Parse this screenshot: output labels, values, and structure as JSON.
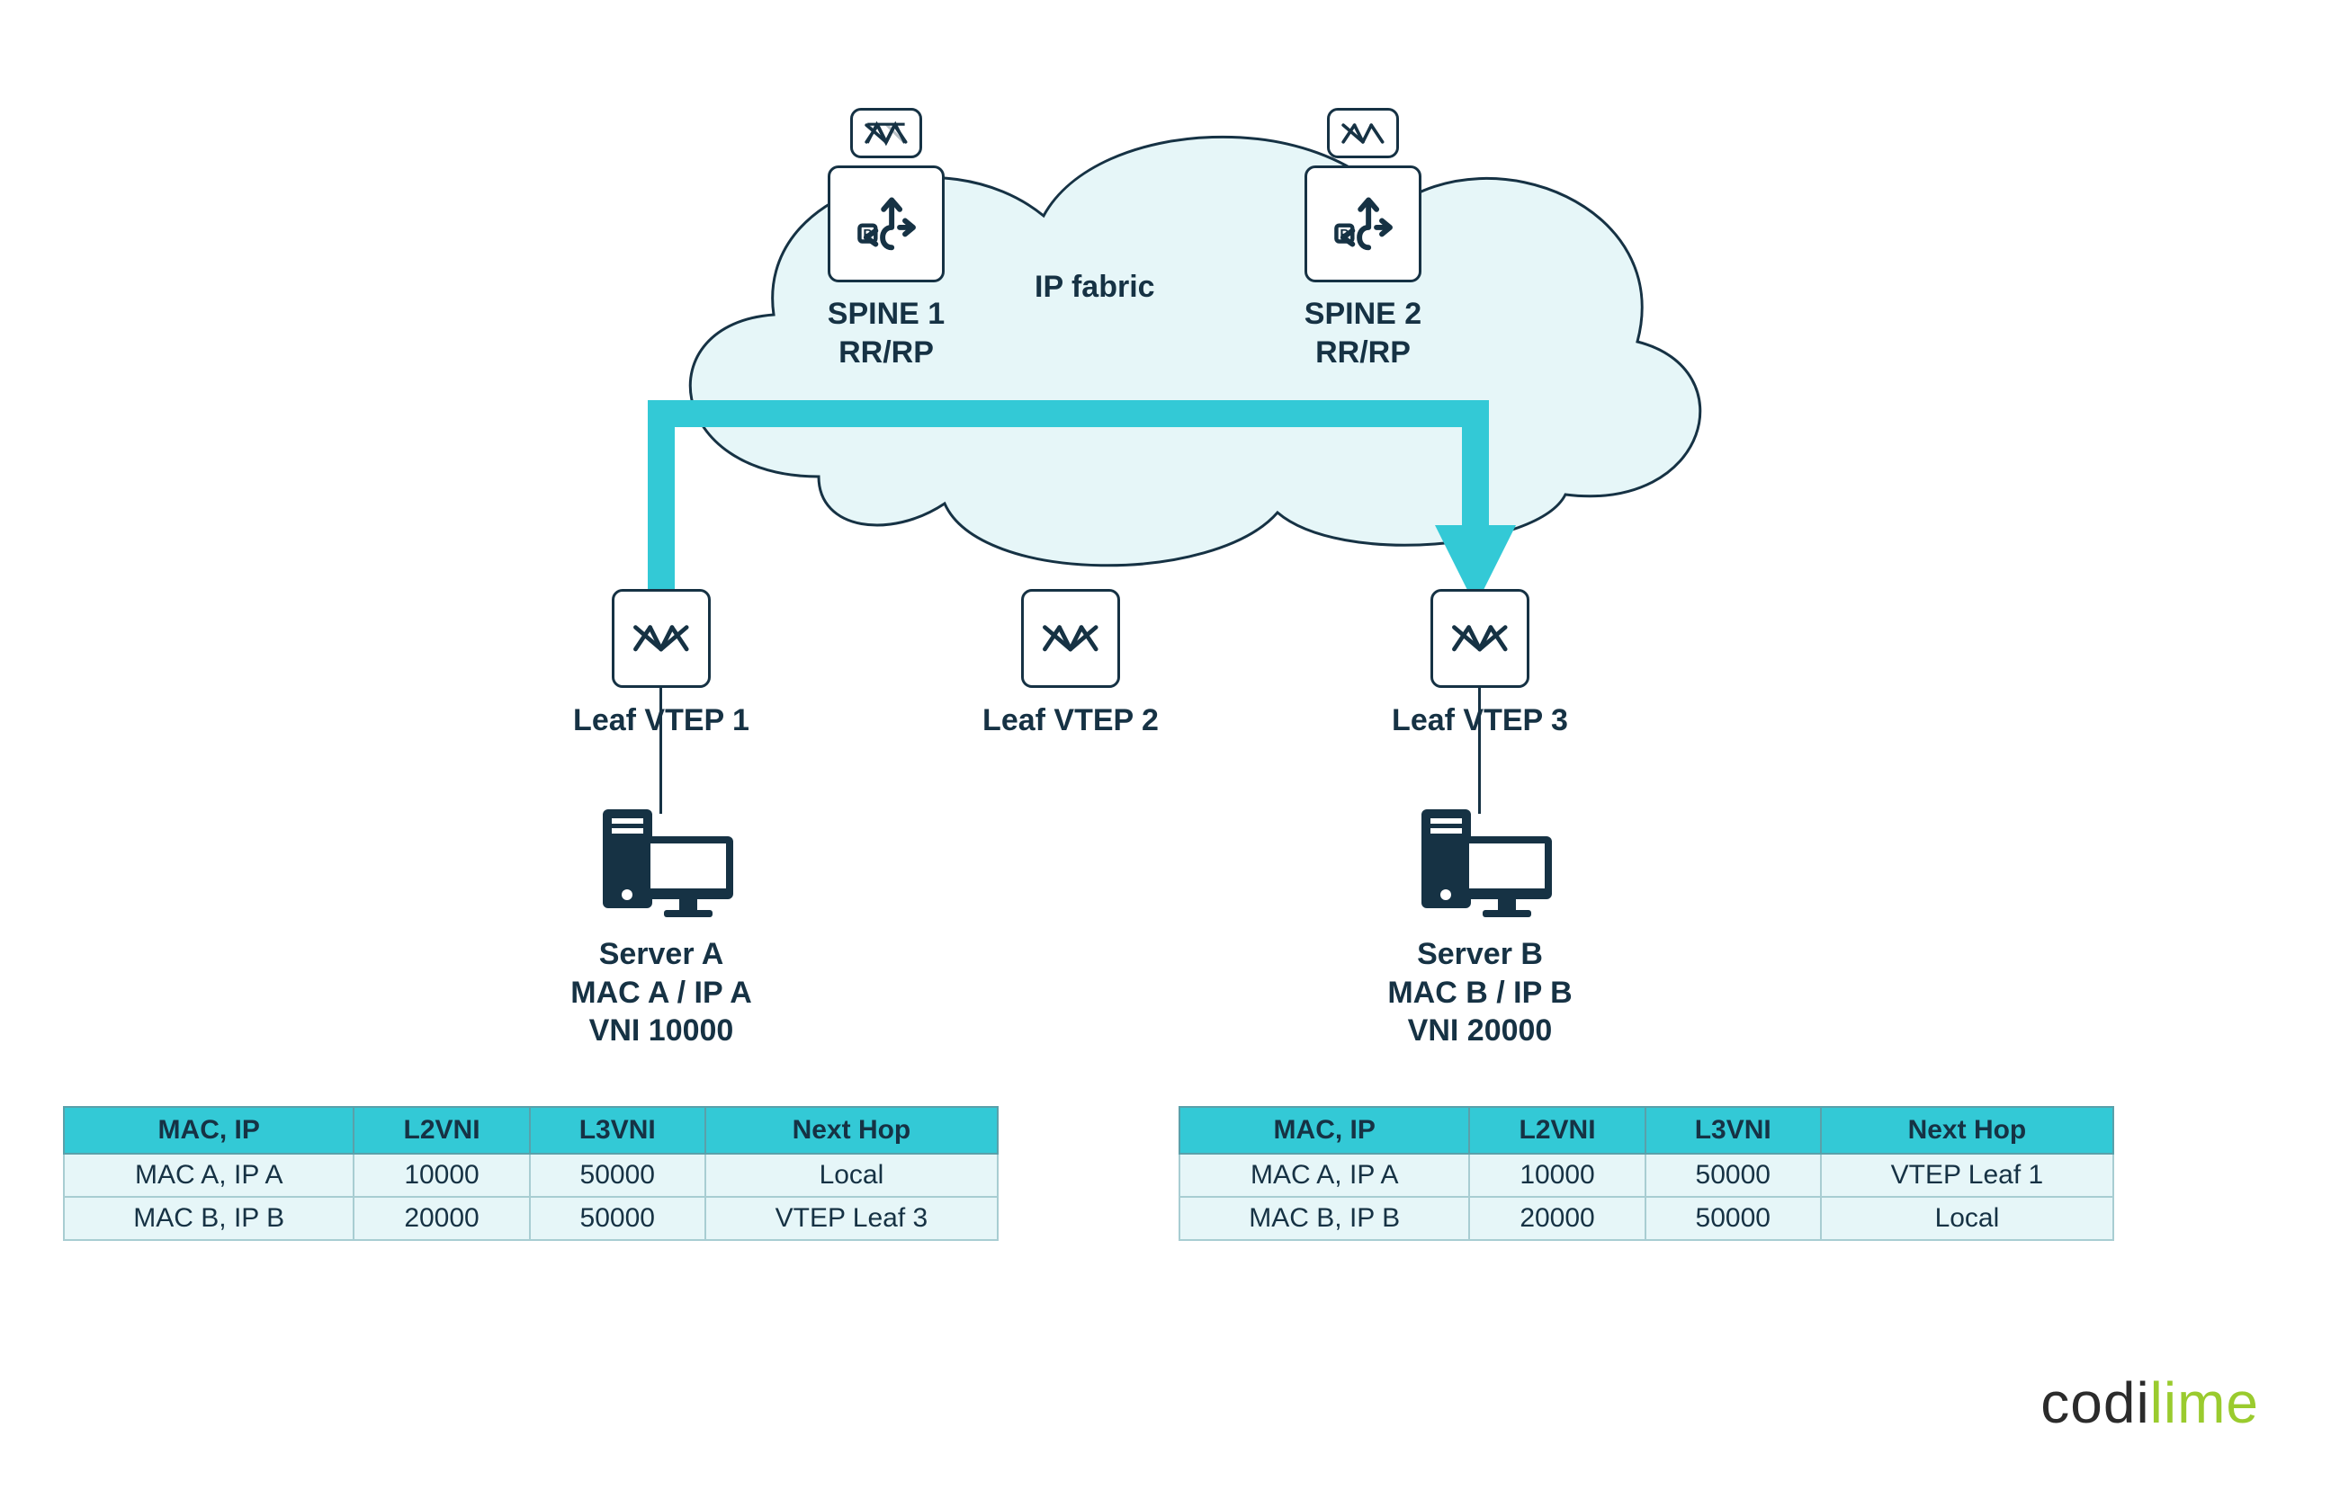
{
  "fabric_label": "IP fabric",
  "spine1": {
    "name": "SPINE 1",
    "role": "RR/RP"
  },
  "spine2": {
    "name": "SPINE 2",
    "role": "RR/RP"
  },
  "leaf1": {
    "label": "Leaf VTEP 1"
  },
  "leaf2": {
    "label": "Leaf VTEP 2"
  },
  "leaf3": {
    "label": "Leaf VTEP 3"
  },
  "serverA": {
    "name": "Server A",
    "macip": "MAC A / IP A",
    "vni": "VNI 10000"
  },
  "serverB": {
    "name": "Server  B",
    "macip": "MAC B / IP B",
    "vni": "VNI 20000"
  },
  "table_headers": {
    "col1": "MAC, IP",
    "col2": "L2VNI",
    "col3": "L3VNI",
    "col4": "Next Hop"
  },
  "tableLeft": {
    "rows": [
      {
        "macip": "MAC A, IP A",
        "l2vni": "10000",
        "l3vni": "50000",
        "nexthop": "Local"
      },
      {
        "macip": "MAC B, IP B",
        "l2vni": "20000",
        "l3vni": "50000",
        "nexthop": "VTEP Leaf 3"
      }
    ]
  },
  "tableRight": {
    "rows": [
      {
        "macip": "MAC A, IP A",
        "l2vni": "10000",
        "l3vni": "50000",
        "nexthop": "VTEP Leaf 1"
      },
      {
        "macip": "MAC B, IP B",
        "l2vni": "20000",
        "l3vni": "50000",
        "nexthop": "Local"
      }
    ]
  },
  "logo": {
    "part1": "codi",
    "part2": "lime"
  },
  "colors": {
    "accent": "#33c9d6",
    "dark": "#163244",
    "lime": "#9acb2e"
  }
}
